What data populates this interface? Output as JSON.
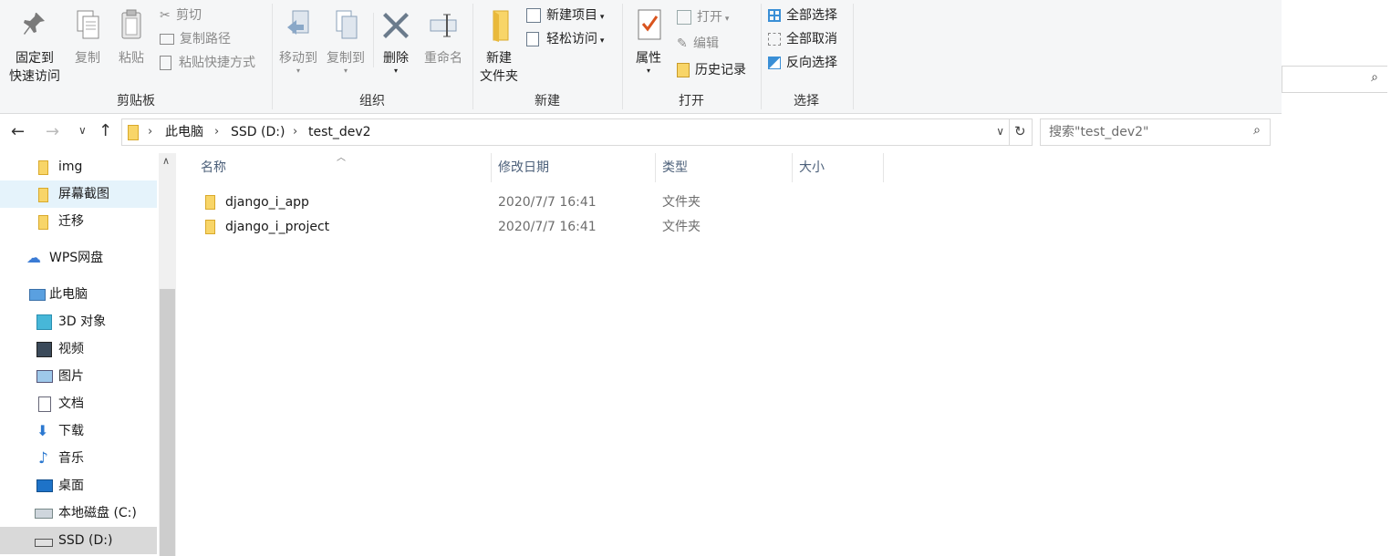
{
  "ribbon": {
    "clipboard": {
      "pin_label_1": "固定到",
      "pin_label_2": "快速访问",
      "copy": "复制",
      "paste": "粘贴",
      "cut": "剪切",
      "copy_path": "复制路径",
      "paste_shortcut": "粘贴快捷方式",
      "group": "剪贴板"
    },
    "organize": {
      "move_to": "移动到",
      "copy_to": "复制到",
      "delete": "删除",
      "rename": "重命名",
      "group": "组织"
    },
    "new": {
      "new_folder_1": "新建",
      "new_folder_2": "文件夹",
      "new_item": "新建项目",
      "easy_access": "轻松访问",
      "group": "新建"
    },
    "open": {
      "properties": "属性",
      "open": "打开",
      "edit": "编辑",
      "history": "历史记录",
      "group": "打开"
    },
    "select": {
      "select_all": "全部选择",
      "select_none": "全部取消",
      "invert": "反向选择",
      "group": "选择"
    }
  },
  "address": {
    "crumbs": [
      "此电脑",
      "SSD (D:)",
      "test_dev2"
    ]
  },
  "search": {
    "placeholder": "搜索\"test_dev2\""
  },
  "nav": {
    "items": [
      {
        "label": "img",
        "icon": "folder-icon"
      },
      {
        "label": "屏幕截图",
        "icon": "folder-icon"
      },
      {
        "label": "迁移",
        "icon": "folder-icon"
      },
      {
        "label": "WPS网盘",
        "icon": "cloud-icon"
      },
      {
        "label": "此电脑",
        "icon": "computer-icon"
      },
      {
        "label": "3D 对象",
        "icon": "cube-icon"
      },
      {
        "label": "视频",
        "icon": "video-icon"
      },
      {
        "label": "图片",
        "icon": "picture-icon"
      },
      {
        "label": "文档",
        "icon": "document-icon"
      },
      {
        "label": "下载",
        "icon": "download-icon"
      },
      {
        "label": "音乐",
        "icon": "music-icon"
      },
      {
        "label": "桌面",
        "icon": "desktop-icon"
      },
      {
        "label": "本地磁盘 (C:)",
        "icon": "drive-icon"
      },
      {
        "label": "SSD (D:)",
        "icon": "drive-icon"
      }
    ]
  },
  "list": {
    "columns": [
      "名称",
      "修改日期",
      "类型",
      "大小"
    ],
    "rows": [
      {
        "name": "django_i_app",
        "date": "2020/7/7 16:41",
        "type": "文件夹",
        "size": ""
      },
      {
        "name": "django_i_project",
        "date": "2020/7/7 16:41",
        "type": "文件夹",
        "size": ""
      }
    ]
  },
  "colors": {
    "folder": "#f8d568",
    "accent": "#0078d7",
    "selection": "#e5f3fb"
  }
}
